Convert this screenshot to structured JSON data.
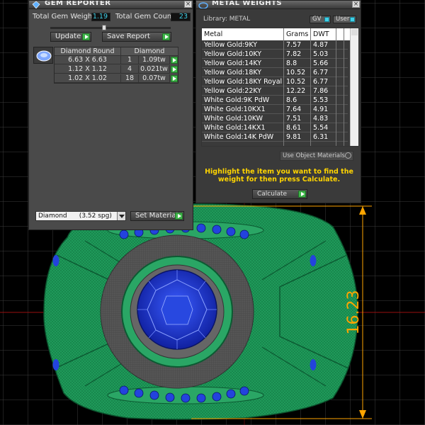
{
  "gem_reporter": {
    "title": "GEM REPORTER",
    "total_gem_weight_label": "Total Gem Weight",
    "total_gem_weight_value": "1.19",
    "total_gem_count_label": "Total Gem Count",
    "total_gem_count_value": "23",
    "update_label": "Update",
    "save_report_label": "Save Report",
    "table": {
      "headers": [
        "Diamond Round",
        "Diamond"
      ],
      "rows": [
        {
          "size": "6.63 X 6.63",
          "count": "1",
          "weight": "1.09tw"
        },
        {
          "size": "1.12 X 1.12",
          "count": "4",
          "weight": "0.021tw"
        },
        {
          "size": "1.02 X 1.02",
          "count": "18",
          "weight": "0.07tw"
        }
      ]
    },
    "material_selected": "Diamond      (3.52 spg)",
    "set_material_label": "Set Material"
  },
  "metal_weights": {
    "title": "METAL WEIGHTS",
    "library_label": "Library: METAL",
    "toggle_gv": "GV",
    "toggle_user": "User",
    "columns": [
      "Metal",
      "Grams",
      "DWT"
    ],
    "rows": [
      {
        "metal": "Yellow Gold:9KY",
        "grams": "7.57",
        "dwt": "4.87"
      },
      {
        "metal": "Yellow Gold:10KY",
        "grams": "7.82",
        "dwt": "5.03"
      },
      {
        "metal": "Yellow Gold:14KY",
        "grams": "8.8",
        "dwt": "5.66"
      },
      {
        "metal": "Yellow Gold:18KY",
        "grams": "10.52",
        "dwt": "6.77"
      },
      {
        "metal": "Yellow Gold:18KY Royal",
        "grams": "10.52",
        "dwt": "6.77"
      },
      {
        "metal": "Yellow Gold:22KY",
        "grams": "12.22",
        "dwt": "7.86"
      },
      {
        "metal": "White Gold:9K PdW",
        "grams": "8.6",
        "dwt": "5.53"
      },
      {
        "metal": "White Gold:10KX1",
        "grams": "7.64",
        "dwt": "4.91"
      },
      {
        "metal": "White Gold:10KW",
        "grams": "7.51",
        "dwt": "4.83"
      },
      {
        "metal": "White Gold:14KX1",
        "grams": "8.61",
        "dwt": "5.54"
      },
      {
        "metal": "White Gold:14K PdW",
        "grams": "9.81",
        "dwt": "6.31"
      }
    ],
    "use_object_materials_label": "Use Object Materials",
    "instruction": "Highlight the item you want to find the weight for then press Calculate.",
    "calculate_label": "Calculate"
  },
  "viewport": {
    "dimension_label": "16.23"
  },
  "colors": {
    "accent_go": "#3fb54a",
    "value_cyan": "#3fd0e8",
    "instruction_yellow": "#ffd400",
    "dimension_orange": "#ffa500",
    "ring_green": "#1f9a5a",
    "gem_blue": "#1a3ccc"
  }
}
